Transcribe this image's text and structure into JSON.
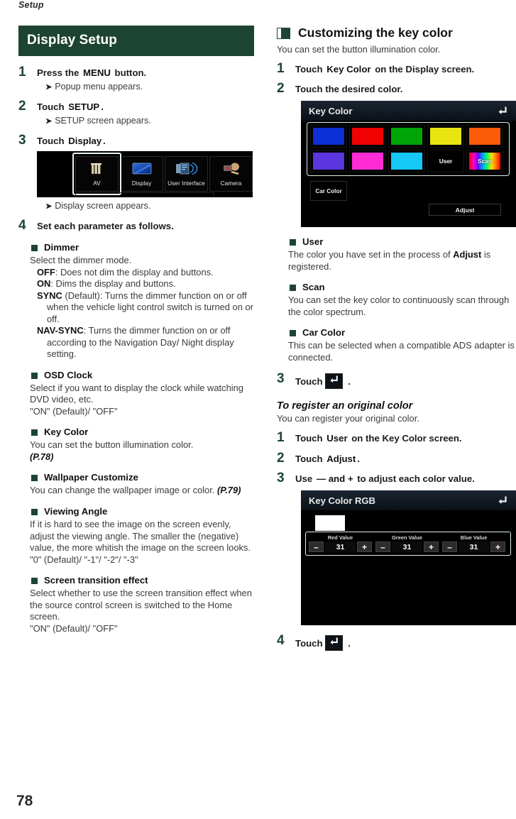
{
  "running_head": "Setup",
  "page_number": "78",
  "left_column": {
    "section_bar_title": "Display Setup",
    "steps": [
      {
        "num": "1",
        "text_pre": "Press the ",
        "keyword": "MENU",
        "text_post": " button.",
        "result": "Popup menu appears."
      },
      {
        "num": "2",
        "text_pre": "Touch ",
        "keyword": "SETUP",
        "text_post": ".",
        "result": "SETUP screen appears."
      },
      {
        "num": "3",
        "text_pre": "Touch ",
        "keyword": "Display",
        "text_post": ".",
        "result": "Display screen appears."
      },
      {
        "num": "4",
        "text_pre": "Set each parameter as follows.",
        "keyword": "",
        "text_post": "",
        "result": ""
      }
    ],
    "setup_screenshot": {
      "tiles": [
        {
          "label": "AV",
          "icon": "av-icon",
          "selected": false
        },
        {
          "label": "Display",
          "icon": "display-icon",
          "selected": true
        },
        {
          "label": "User Interface",
          "icon": "user-interface-icon",
          "selected": false
        },
        {
          "label": "Camera",
          "icon": "camera-icon",
          "selected": false
        }
      ]
    },
    "parameters": [
      {
        "heading": "Dimmer",
        "lines": [
          {
            "style": "plain",
            "text": "Select the dimmer mode."
          },
          {
            "style": "option",
            "term": "OFF",
            "text": ": Does not dim the display and buttons."
          },
          {
            "style": "option",
            "term": "ON",
            "text": ": Dims the display and buttons."
          },
          {
            "style": "option",
            "term": "SYNC",
            "text": " (Default): Turns the dimmer function on or off when the vehicle light control switch is turned on or off."
          },
          {
            "style": "option",
            "term": "NAV-SYNC",
            "text": ": Turns the dimmer function on or off according to the Navigation Day/ Night display setting."
          }
        ]
      },
      {
        "heading": "OSD Clock",
        "lines": [
          {
            "style": "plain",
            "text": "Select if you want to display the clock while watching DVD video, etc."
          },
          {
            "style": "plain",
            "text": "\"ON\" (Default)/ \"OFF\""
          }
        ]
      },
      {
        "heading": "Key Color",
        "lines": [
          {
            "style": "plain",
            "text": "You can set the button illumination color."
          },
          {
            "style": "ref",
            "text": "(P.78)"
          }
        ]
      },
      {
        "heading": "Wallpaper Customize",
        "lines": [
          {
            "style": "plain-with-ref",
            "text": "You can change the wallpaper image or color. ",
            "ref": "(P.79)"
          }
        ]
      },
      {
        "heading": "Viewing Angle",
        "lines": [
          {
            "style": "plain",
            "text": "If it is hard to see the image on the screen evenly, adjust the viewing angle. The smaller the (negative) value, the more whitish the image on the screen looks."
          },
          {
            "style": "plain",
            "text": "\"0\" (Default)/ \"-1\"/ \"-2\"/ \"-3\""
          }
        ]
      },
      {
        "heading": "Screen transition effect",
        "lines": [
          {
            "style": "plain",
            "text": "Select whether to use the screen transition effect when the source control screen is switched to the Home screen."
          },
          {
            "style": "plain",
            "text": "\"ON\" (Default)/ \"OFF\""
          }
        ]
      }
    ]
  },
  "right_column": {
    "chapter_title": "Customizing the key color",
    "chapter_intro": "You can set the button illumination color.",
    "steps_top": [
      {
        "num": "1",
        "pre": "Touch ",
        "keyword": "Key Color",
        "post": " on the Display screen."
      },
      {
        "num": "2",
        "pre": "Touch the desired color.",
        "keyword": "",
        "post": ""
      }
    ],
    "key_color_screen": {
      "title": "Key Color",
      "back_icon": "back-arrow-icon",
      "swatches": [
        {
          "name": "blue",
          "color": "#0d2fd6",
          "label": ""
        },
        {
          "name": "red",
          "color": "#f10202",
          "label": ""
        },
        {
          "name": "green",
          "color": "#00a508",
          "label": ""
        },
        {
          "name": "yellow",
          "color": "#e8e511",
          "label": ""
        },
        {
          "name": "orange",
          "color": "#fb5a06",
          "label": ""
        },
        {
          "name": "purple",
          "color": "#5b35dd",
          "label": ""
        },
        {
          "name": "magenta",
          "color": "#ff2cd6",
          "label": ""
        },
        {
          "name": "cyan",
          "color": "#16c8f5",
          "label": ""
        },
        {
          "name": "user",
          "color": "#000000",
          "label": "User"
        },
        {
          "name": "scan",
          "color": "spectrum",
          "label": "Scan"
        }
      ],
      "car_color_button": "Car Color",
      "adjust_button": "Adjust"
    },
    "descriptions": [
      {
        "heading": "User",
        "text_pre": "The color you have set in the process of ",
        "bold_term": "Adjust",
        "text_post": " is registered."
      },
      {
        "heading": "Scan",
        "text_pre": "You can set the key color to continuously scan through the color spectrum.",
        "bold_term": "",
        "text_post": ""
      },
      {
        "heading": "Car Color",
        "text_pre": "This can be selected when a compatible ADS adapter is connected.",
        "bold_term": "",
        "text_post": ""
      }
    ],
    "step_touch_back_1": {
      "num": "3",
      "pre": "Touch ",
      "icon": "back-arrow-icon",
      "post": "."
    },
    "subsection_title": "To register an original color",
    "subsection_intro": "You can register your original color.",
    "steps_bottom": [
      {
        "num": "1",
        "pre": "Touch ",
        "keyword": "User",
        "post": " on the Key Color screen."
      },
      {
        "num": "2",
        "pre": "Touch ",
        "keyword": "Adjust",
        "post": "."
      },
      {
        "num": "3",
        "pre": "Use ",
        "keyword": "—  and  +",
        "post": " to adjust each color value."
      }
    ],
    "rgb_screen": {
      "title": "Key Color RGB",
      "back_icon": "back-arrow-icon",
      "preview_color": "#ffffff",
      "channels": [
        {
          "label": "Red Value",
          "value": "31",
          "minus": "–",
          "plus": "+"
        },
        {
          "label": "Green Value",
          "value": "31",
          "minus": "–",
          "plus": "+"
        },
        {
          "label": "Blue Value",
          "value": "31",
          "minus": "–",
          "plus": "+"
        }
      ]
    },
    "step_touch_back_2": {
      "num": "4",
      "pre": "Touch ",
      "icon": "back-arrow-icon",
      "post": "."
    }
  },
  "colors": {
    "accent_green": "#1d4433",
    "body_text": "#3b3b3b",
    "heading_text": "#111111"
  }
}
